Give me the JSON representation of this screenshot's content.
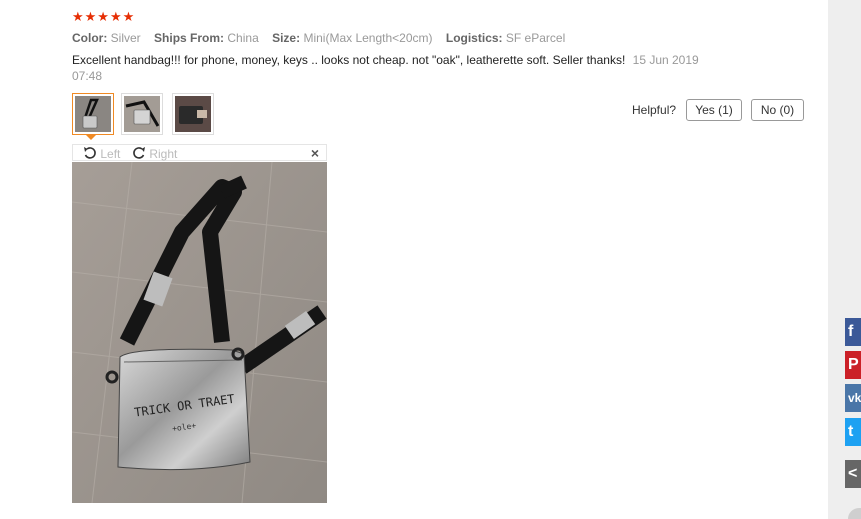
{
  "review": {
    "stars": "★★★★★",
    "attributes": [
      {
        "key": "Color:",
        "value": "Silver"
      },
      {
        "key": "Ships From:",
        "value": "China"
      },
      {
        "key": "Size:",
        "value": "Mini(Max Length<20cm)"
      },
      {
        "key": "Logistics:",
        "value": "SF eParcel"
      }
    ],
    "text": "Excellent handbag!!! for phone, money, keys .. looks not cheap. not \"oak\", leatherette soft. Seller thanks!",
    "date": "15 Jun 2019 07:48"
  },
  "feedback": {
    "helpful_label": "Helpful?",
    "yes_label": "Yes (1)",
    "no_label": "No (0)"
  },
  "viewer": {
    "rotate_left_label": "Left",
    "rotate_right_label": "Right",
    "close_label": "×",
    "bag_text_line1": "TRICK OR TRAET",
    "bag_text_line2": "+ole+"
  },
  "share": [
    {
      "network": "facebook",
      "glyph": "f",
      "color": "#3b5998"
    },
    {
      "network": "pinterest",
      "glyph": "P",
      "color": "#cb2027"
    },
    {
      "network": "vk",
      "glyph": "vk",
      "color": "#4a76a8"
    },
    {
      "network": "twitter",
      "glyph": "t",
      "color": "#1da1f2"
    },
    {
      "network": "more",
      "glyph": "<",
      "color": "#666666"
    }
  ]
}
